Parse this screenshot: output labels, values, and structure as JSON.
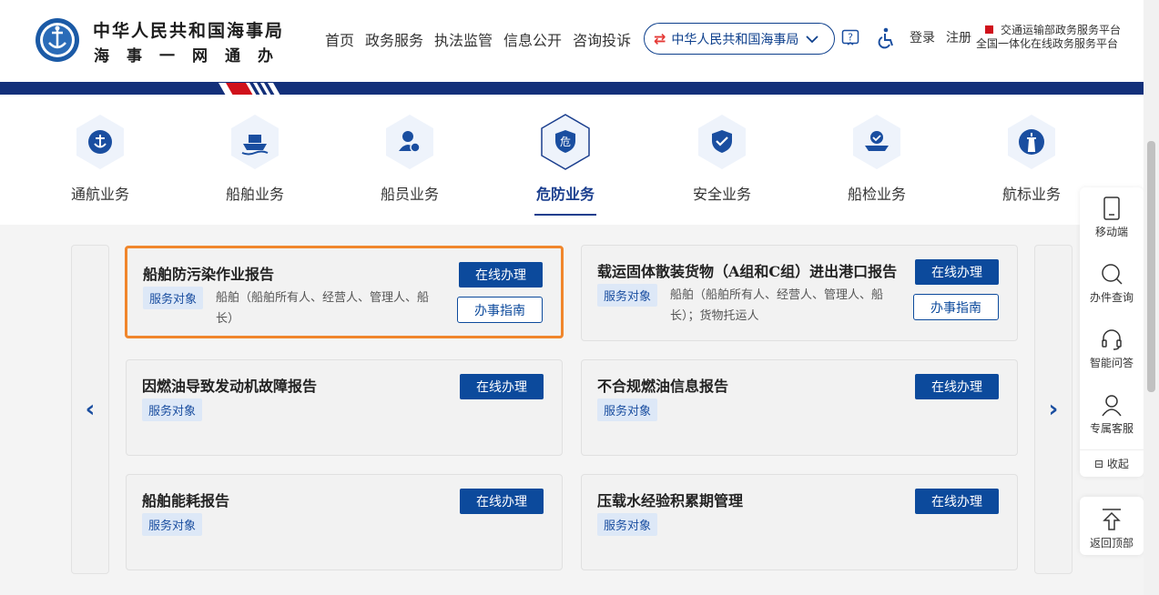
{
  "header": {
    "logo_title": "中华人民共和国海事局",
    "logo_sub": "海事一网通办",
    "nav": [
      "首页",
      "政务服务",
      "执法监管",
      "信息公开",
      "咨询投诉"
    ],
    "org_select": "中华人民共和国海事局",
    "login": "登录",
    "register": "注册",
    "platform_line1": "交通运输部政务服务平台",
    "platform_line2": "全国一体化在线政务服务平台"
  },
  "categories": [
    {
      "label": "通航业务",
      "icon": "anchor-icon"
    },
    {
      "label": "船舶业务",
      "icon": "ship-icon"
    },
    {
      "label": "船员业务",
      "icon": "crew-icon"
    },
    {
      "label": "危防业务",
      "icon": "danger-icon",
      "glyph": "危",
      "active": true
    },
    {
      "label": "安全业务",
      "icon": "shield-check-icon"
    },
    {
      "label": "船检业务",
      "icon": "ship-inspection-icon"
    },
    {
      "label": "航标业务",
      "icon": "lighthouse-icon"
    }
  ],
  "cards": [
    {
      "title": "船舶防污染作业报告",
      "tag": "服务对象",
      "desc": "船舶（船舶所有人、经营人、管理人、船长）",
      "online": "在线办理",
      "guide": "办事指南"
    },
    {
      "title": "载运固体散装货物（A组和C组）进出港口报告",
      "tag": "服务对象",
      "desc": "船舶（船舶所有人、经营人、管理人、船长）；货物托运人",
      "online": "在线办理",
      "guide": "办事指南"
    },
    {
      "title": "因燃油导致发动机故障报告",
      "tag": "服务对象",
      "online": "在线办理"
    },
    {
      "title": "不合规燃油信息报告",
      "tag": "服务对象",
      "online": "在线办理"
    },
    {
      "title": "船舶能耗报告",
      "tag": "服务对象",
      "online": "在线办理"
    },
    {
      "title": "压载水经验积累期管理",
      "tag": "服务对象",
      "online": "在线办理"
    }
  ],
  "float_panel": {
    "mobile": "移动端",
    "query": "办件查询",
    "qa": "智能问答",
    "service": "专属客服",
    "collapse": "收起",
    "top": "返回顶部"
  },
  "colors": {
    "primary": "#0c4a9c",
    "band": "#13307a",
    "highlight": "#f0862c",
    "accent_red": "#d0111b"
  }
}
